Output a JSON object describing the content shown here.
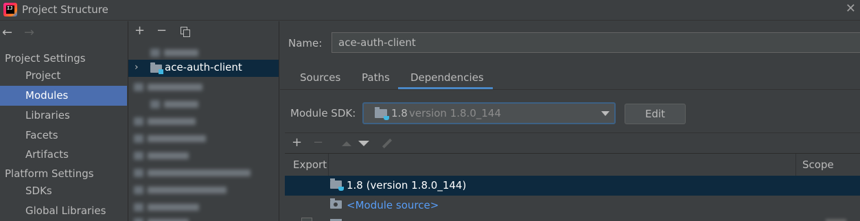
{
  "window": {
    "title": "Project Structure",
    "app_icon_text": "IJ",
    "close_glyph": "✕"
  },
  "nav": {
    "back_glyph": "←",
    "forward_glyph": "→"
  },
  "settings": {
    "project_settings_header": "Project Settings",
    "project_items": [
      "Project",
      "Modules",
      "Libraries",
      "Facets",
      "Artifacts"
    ],
    "selected_item": "Modules",
    "platform_settings_header": "Platform Settings",
    "platform_items": [
      "SDKs",
      "Global Libraries"
    ]
  },
  "modules_panel": {
    "add_glyph": "+",
    "remove_glyph": "−",
    "selected_module": "ace-auth-client",
    "expand_glyph": "›"
  },
  "module_details": {
    "name_label": "Name:",
    "name_value": "ace-auth-client",
    "tabs": [
      "Sources",
      "Paths",
      "Dependencies"
    ],
    "active_tab": "Dependencies",
    "sdk_label": "Module SDK:",
    "sdk_name": "1.8",
    "sdk_version": "version 1.8.0_144",
    "edit_label": "Edit"
  },
  "dependencies": {
    "toolbar": {
      "add_glyph": "+",
      "remove_glyph": "−"
    },
    "columns": [
      "Export",
      "Scope"
    ],
    "rows": [
      {
        "label": "1.8 (version 1.8.0_144)",
        "kind": "sdk",
        "selected": true
      },
      {
        "label": "<Module source>",
        "kind": "source",
        "selected": false
      }
    ]
  },
  "colors": {
    "background": "#3c3f41",
    "selection": "#4b6eaf",
    "row_selection": "#0d293e",
    "link": "#589df6",
    "tab_underline": "#4a88c7"
  }
}
